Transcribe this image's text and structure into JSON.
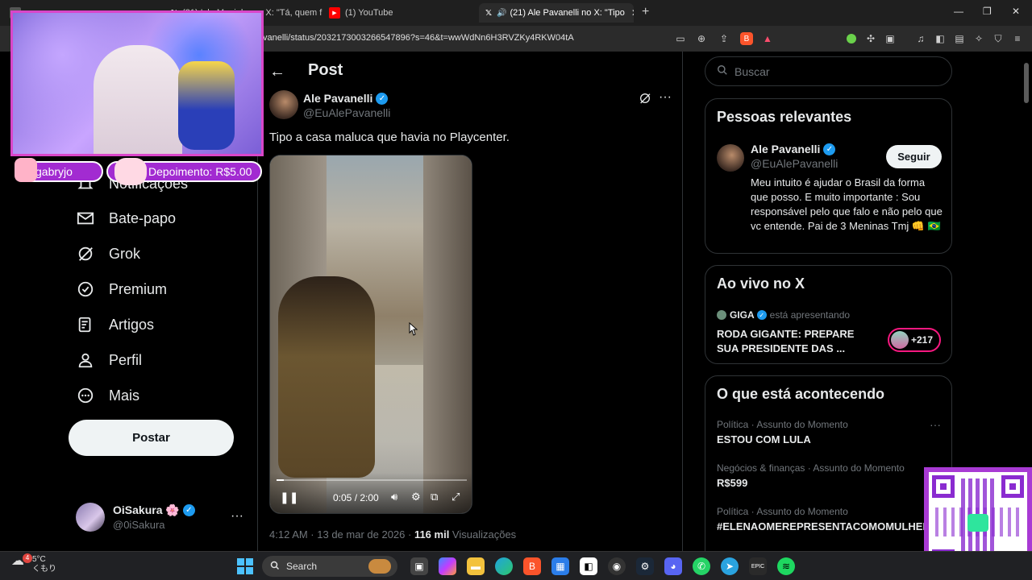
{
  "browser": {
    "tabs": [
      {
        "label": "",
        "active": false
      },
      {
        "label": "(21) Isla Meninho no X: \"Tá, quem f",
        "active": false
      },
      {
        "label": "(1) YouTube",
        "active": false
      },
      {
        "label": "(21) Ale Pavanelli no X: \"Tipo",
        "active": true
      }
    ],
    "tab_close": "✕",
    "new_tab": "+",
    "url": "vanelli/status/2032173003266547896?s=46&t=wwWdNn6H3RVZKy4RKW04tA"
  },
  "stream": {
    "sub_user": "gabryjo",
    "donation": "Depoimento: R$5.00"
  },
  "nav": {
    "items": [
      {
        "label": "Notificações",
        "icon": "bell-icon"
      },
      {
        "label": "Bate-papo",
        "icon": "mail-icon"
      },
      {
        "label": "Grok",
        "icon": "grok-icon"
      },
      {
        "label": "Premium",
        "icon": "premium-icon"
      },
      {
        "label": "Artigos",
        "icon": "articles-icon"
      },
      {
        "label": "Perfil",
        "icon": "person-icon"
      },
      {
        "label": "Mais",
        "icon": "more-circle-icon"
      }
    ],
    "post_button": "Postar"
  },
  "account": {
    "name": "OiSakura 🌸",
    "handle": "@0iSakura"
  },
  "post": {
    "header": "Post",
    "author_name": "Ale Pavanelli",
    "author_handle": "@EuAlePavanelli",
    "text": "Tipo a casa maluca que havia no Playcenter.",
    "video_time": "0:05 / 2:00",
    "video_progress": 0.04,
    "time": "4:12 AM · 13 de mar de 2026 · ",
    "views_count": "116 mil",
    "views_label": " Visualizações"
  },
  "right": {
    "search_placeholder": "Buscar",
    "relevant": {
      "title": "Pessoas relevantes",
      "name": "Ale Pavanelli",
      "handle": "@EuAlePavanelli",
      "follow": "Seguir",
      "bio": "Meu intuito é ajudar o Brasil da forma que posso. E muito importante : Sou responsável pelo que falo e não pelo que vc entende. Pai de 3 Meninas Tmj 👊 🇧🇷"
    },
    "live": {
      "title": "Ao vivo no X",
      "host": "GIGA",
      "host_suffix": "está apresentando",
      "stream_title": "RODA GIGANTE: PREPARE SUA PRESIDENTE DAS ...",
      "count": "+217"
    },
    "trends": {
      "title": "O que está acontecendo",
      "items": [
        {
          "context": "Política · Assunto do Momento",
          "topic": "ESTOU COM LULA"
        },
        {
          "context": "Negócios & finanças · Assunto do Momento",
          "topic": "R$599"
        },
        {
          "context": "Política · Assunto do Momento",
          "topic": "#ELENAOMEREPRESENTACOMOMULHER"
        }
      ]
    }
  },
  "taskbar": {
    "weather_temp": "5°C",
    "weather_desc": "くもり",
    "weather_badge": "4",
    "search": "Search"
  }
}
